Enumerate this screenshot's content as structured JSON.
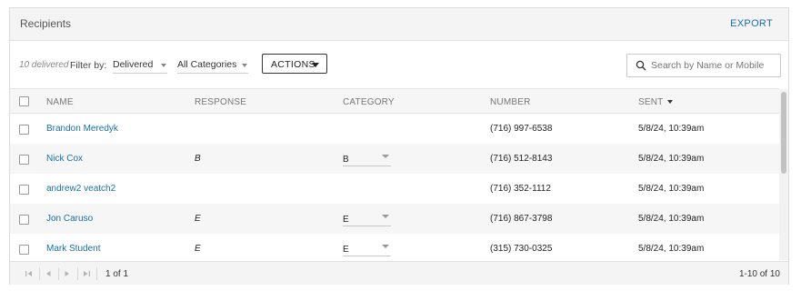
{
  "header": {
    "title": "Recipients",
    "export_label": "EXPORT"
  },
  "filters": {
    "delivered_count": "10 delivered",
    "filter_label": "Filter by:",
    "status_value": "Delivered",
    "category_value": "All Categories",
    "actions_label": "ACTIONS"
  },
  "search": {
    "placeholder": "Search by Name or Mobile",
    "value": ""
  },
  "columns": {
    "name": "NAME",
    "response": "RESPONSE",
    "category": "CATEGORY",
    "number": "NUMBER",
    "sent": "SENT"
  },
  "rows": [
    {
      "name": "Brandon Meredyk",
      "response": "",
      "category": "",
      "number": "(716) 997-6538",
      "sent": "5/8/24, 10:39am"
    },
    {
      "name": "Nick Cox",
      "response": "B",
      "category": "B",
      "number": "(716) 512-8143",
      "sent": "5/8/24, 10:39am"
    },
    {
      "name": "andrew2 veatch2",
      "response": "",
      "category": "",
      "number": "(716) 352-1112",
      "sent": "5/8/24, 10:39am"
    },
    {
      "name": "Jon Caruso",
      "response": "E",
      "category": "E",
      "number": "(716) 867-3798",
      "sent": "5/8/24, 10:39am"
    },
    {
      "name": "Mark Student",
      "response": "E",
      "category": "E",
      "number": "(315) 730-0325",
      "sent": "5/8/24, 10:39am"
    }
  ],
  "pagination": {
    "page_info": "1 of 1",
    "range_info": "1-10 of 10"
  },
  "icons": {
    "search": "search-icon",
    "first": "first-page-icon",
    "prev": "prev-page-icon",
    "next": "next-page-icon",
    "last": "last-page-icon"
  },
  "colors": {
    "link": "#1a6fa5",
    "header_bg": "#f4f4f4",
    "alt_row": "#f6f6f6"
  }
}
